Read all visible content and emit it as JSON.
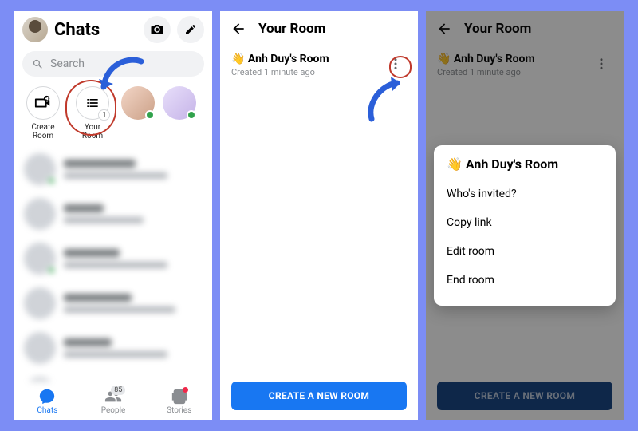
{
  "screen1": {
    "title": "Chats",
    "search_placeholder": "Search",
    "create_room_label": "Create\nRoom",
    "your_room_label": "Your\nRoom",
    "your_room_badge": "1",
    "nav": {
      "chats": "Chats",
      "people": "People",
      "people_badge": "85",
      "stories": "Stories"
    }
  },
  "screen2": {
    "header": "Your Room",
    "room_name": "👋 Anh Duy's Room",
    "room_sub": "Created 1 minute ago",
    "create_btn": "CREATE A NEW ROOM"
  },
  "screen3": {
    "header": "Your Room",
    "room_name": "👋 Anh Duy's Room",
    "room_sub": "Created 1 minute ago",
    "create_btn": "CREATE A NEW ROOM",
    "sheet_title": "👋 Anh Duy's Room",
    "sheet_items": {
      "whos_invited": "Who's invited?",
      "copy_link": "Copy link",
      "edit_room": "Edit room",
      "end_room": "End room"
    }
  }
}
